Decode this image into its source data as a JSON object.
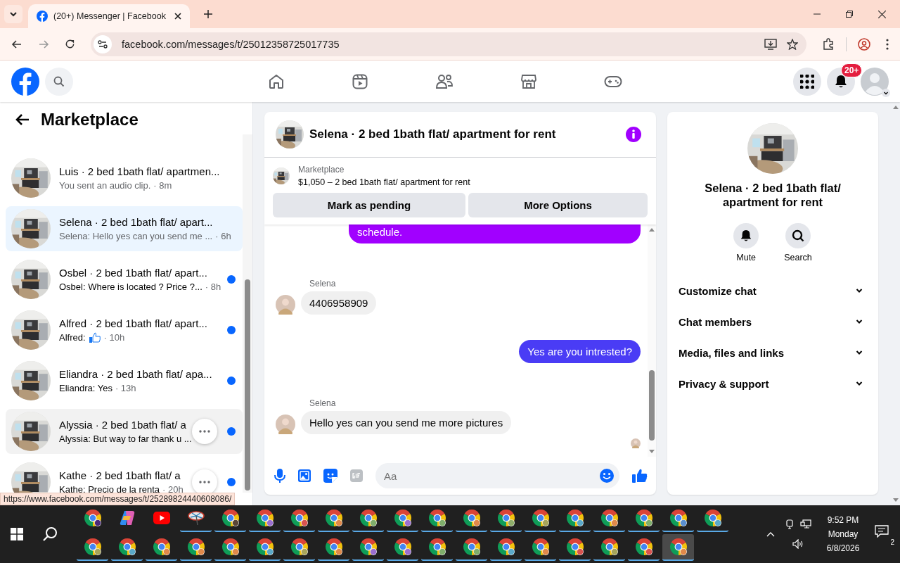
{
  "browser": {
    "tab_title": "(20+) Messenger | Facebook",
    "url": "facebook.com/messages/t/25012358725017735",
    "status_url": "https://www.facebook.com/messages/t/25289824440608086/"
  },
  "facebook_header": {
    "notification_badge": "20+"
  },
  "sidebar": {
    "title": "Marketplace",
    "chats": [
      {
        "title": "Luis · 2 bed 1bath flat/ apartmen...",
        "preview": "You sent an audio clip.",
        "time": "· 8m",
        "unread": false,
        "selected": false,
        "hovered": false,
        "more_button": false
      },
      {
        "title": "Selena · 2 bed 1bath flat/ apart...",
        "preview": "Selena: Hello yes can you send me ...",
        "time": "· 6h",
        "unread": false,
        "selected": true,
        "hovered": false,
        "more_button": false
      },
      {
        "title": "Osbel · 2 bed 1bath flat/ apart...",
        "preview": "Osbel: Where is located ? Price ?...",
        "time": "· 8h",
        "unread": true,
        "selected": false,
        "hovered": false,
        "more_button": false
      },
      {
        "title": "Alfred · 2 bed 1bath flat/ apart...",
        "preview": "Alfred:",
        "preview_like": true,
        "time": "· 10h",
        "unread": true,
        "selected": false,
        "hovered": false,
        "more_button": false
      },
      {
        "title": "Eliandra · 2 bed 1bath flat/ apa...",
        "preview": "Eliandra: Yes",
        "time": "· 13h",
        "unread": true,
        "selected": false,
        "hovered": false,
        "more_button": false
      },
      {
        "title": "Alyssia · 2 bed 1bath flat/ a",
        "preview": "Alyssia: But way to far thank u ...",
        "unread": true,
        "selected": false,
        "hovered": true,
        "more_button": true
      },
      {
        "title": "Kathe · 2 bed 1bath flat/ a",
        "preview": "Kathe: Precio de la renta",
        "time": "· 20h",
        "unread": true,
        "selected": false,
        "hovered": false,
        "more_button": true
      }
    ]
  },
  "conversation": {
    "title": "Selena · 2 bed 1bath flat/ apartment for rent",
    "listing": {
      "label": "Marketplace",
      "price_title": "$1,050 – 2 bed 1bath flat/ apartment for rent"
    },
    "actions": [
      "Mark as pending",
      "More Options"
    ],
    "messages": [
      {
        "kind": "outgoing",
        "text": "schedule.",
        "color": "#a100ff",
        "clipped": true
      },
      {
        "kind": "incoming",
        "sender": "Selena",
        "text": "4406958909"
      },
      {
        "kind": "outgoing",
        "text": "Yes are you intrested?",
        "color": "#4a3cf5",
        "clipped": false
      },
      {
        "kind": "incoming",
        "sender": "Selena",
        "text": "Hello yes can you send me more pictures"
      }
    ],
    "seen": true,
    "composer": {
      "placeholder": "Aa",
      "gif_disabled": true
    }
  },
  "details": {
    "title": "Selena · 2 bed 1bath flat/ apartment for rent",
    "actions": [
      {
        "kind": "mute",
        "label": "Mute"
      },
      {
        "kind": "search",
        "label": "Search"
      }
    ],
    "sections": [
      {
        "label": "Customize chat",
        "expanded": false
      },
      {
        "label": "Chat members",
        "expanded": false
      },
      {
        "label": "Media, files and links",
        "expanded": false
      },
      {
        "label": "Privacy & support",
        "expanded": false
      }
    ]
  },
  "taskbar": {
    "rows": [
      [
        {
          "kind": "chrome",
          "color": "#4b2a7a",
          "running": false,
          "active": false
        },
        {
          "kind": "copilot",
          "running": false,
          "active": false
        },
        {
          "kind": "youtube",
          "running": false,
          "active": false
        },
        {
          "kind": "app",
          "running": true,
          "active": false
        },
        {
          "kind": "chrome",
          "color": "#5a4636",
          "running": true,
          "active": false
        },
        {
          "kind": "chrome",
          "color": "#9b6fd0",
          "running": true,
          "active": false
        },
        {
          "kind": "chrome",
          "color": "#d9534f",
          "running": true,
          "active": false
        },
        {
          "kind": "chrome",
          "color": "#e0894a",
          "running": true,
          "active": false
        },
        {
          "kind": "chrome",
          "color": "#7fae6b",
          "running": true,
          "active": false
        },
        {
          "kind": "chrome",
          "color": "#9b6fd0",
          "running": true,
          "active": false
        },
        {
          "kind": "chrome",
          "color": "#7fae6b",
          "running": true,
          "active": false
        },
        {
          "kind": "chrome",
          "color": "#e0894a",
          "running": true,
          "active": false
        },
        {
          "kind": "chrome",
          "color": "#8fae6b",
          "running": true,
          "active": false
        },
        {
          "kind": "chrome",
          "color": "#a7a45a",
          "running": true,
          "active": false
        },
        {
          "kind": "chrome",
          "color": "#5aa9c9",
          "running": true,
          "active": false
        },
        {
          "kind": "chrome",
          "color": "#e0894a",
          "running": true,
          "active": false
        },
        {
          "kind": "chrome",
          "color": "#7fae6b",
          "running": true,
          "active": false
        },
        {
          "kind": "chrome",
          "color": "#5a8fd0",
          "running": true,
          "active": false
        },
        {
          "kind": "chrome",
          "color": "#5aa9c9",
          "running": true,
          "active": false
        }
      ],
      [
        {
          "kind": "chrome",
          "color": "#a7a45a",
          "running": true,
          "active": false
        },
        {
          "kind": "chrome",
          "color": "#5aa9c9",
          "running": true,
          "active": false
        },
        {
          "kind": "chrome",
          "color": "#e0894a",
          "running": true,
          "active": false
        },
        {
          "kind": "chrome",
          "color": "#e0894a",
          "running": true,
          "active": false
        },
        {
          "kind": "chrome",
          "color": "#e0894a",
          "running": true,
          "active": false
        },
        {
          "kind": "chrome",
          "color": "#5aa9c9",
          "running": true,
          "active": false
        },
        {
          "kind": "chrome",
          "color": "#a7a45a",
          "running": true,
          "active": false
        },
        {
          "kind": "chrome",
          "color": "#e0894a",
          "running": true,
          "active": false
        },
        {
          "kind": "chrome",
          "color": "#9b6fd0",
          "running": true,
          "active": false
        },
        {
          "kind": "chrome",
          "color": "#9b6fd0",
          "running": true,
          "active": false
        },
        {
          "kind": "chrome",
          "color": "#7fae6b",
          "running": true,
          "active": false
        },
        {
          "kind": "chrome",
          "color": "#7fae6b",
          "running": true,
          "active": false
        },
        {
          "kind": "chrome",
          "color": "#5aa9c9",
          "running": true,
          "active": false
        },
        {
          "kind": "chrome",
          "color": "#e0894a",
          "running": true,
          "active": false
        },
        {
          "kind": "chrome",
          "color": "#d9534f",
          "running": true,
          "active": false
        },
        {
          "kind": "chrome",
          "color": "#a7a45a",
          "running": true,
          "active": false
        },
        {
          "kind": "chrome",
          "color": "#d9534f",
          "running": true,
          "active": false
        },
        {
          "kind": "chrome",
          "color": "#e0894a",
          "running": true,
          "active": true
        }
      ]
    ],
    "time": "9:52 PM",
    "day": "Monday",
    "date": "6/8/2026",
    "notification_count": "2"
  }
}
